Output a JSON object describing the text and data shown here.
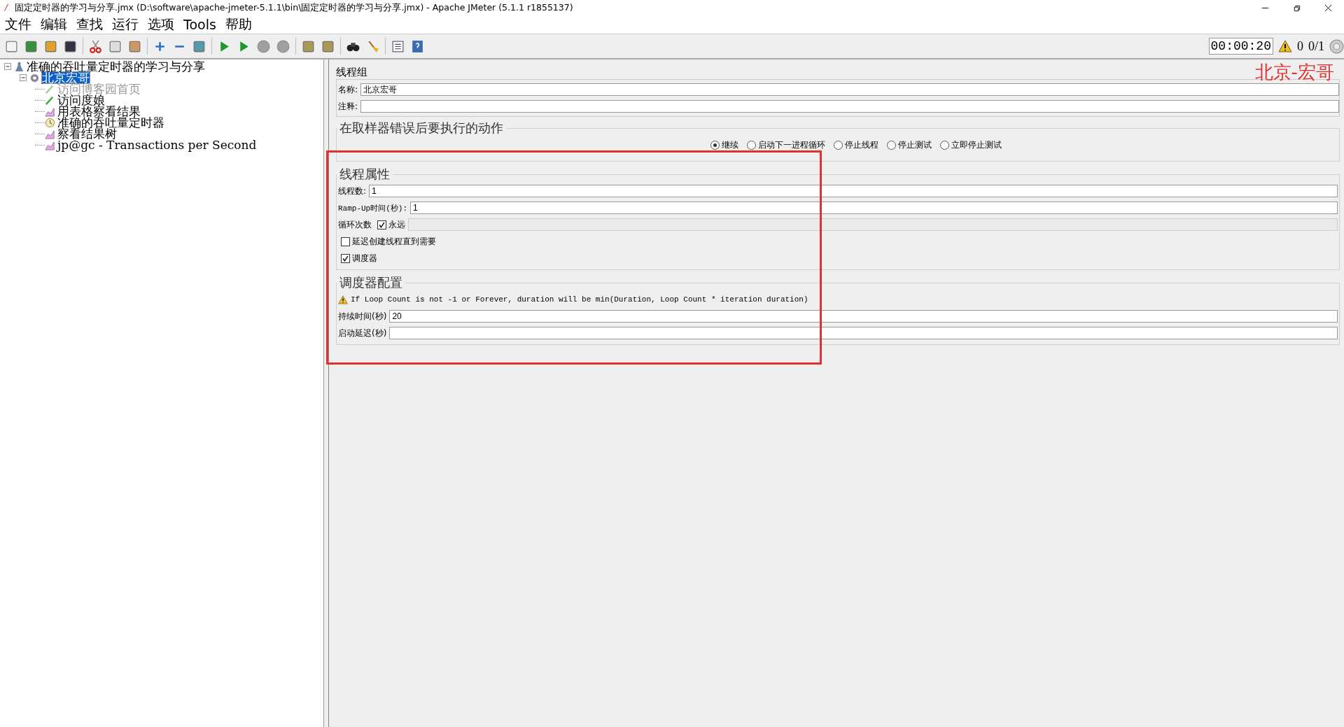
{
  "window": {
    "title": "固定定时器的学习与分享.jmx (D:\\software\\apache-jmeter-5.1.1\\bin\\固定定时器的学习与分享.jmx) - Apache JMeter (5.1.1 r1855137)"
  },
  "menu": [
    "文件",
    "编辑",
    "查找",
    "运行",
    "选项",
    "Tools",
    "帮助"
  ],
  "toolbar": [
    {
      "disabled": false
    },
    {
      "disabled": false
    },
    {
      "disabled": false
    },
    {
      "disabled": false
    },
    {
      "disabled": false
    },
    {
      "disabled": false
    },
    {
      "disabled": false
    },
    {
      "disabled": false
    },
    {
      "disabled": false
    },
    {
      "disabled": false
    },
    {
      "disabled": false
    },
    {
      "disabled": false
    },
    {
      "disabled": true
    },
    {
      "disabled": true
    },
    {
      "disabled": false
    },
    {
      "disabled": false
    },
    {
      "disabled": false
    },
    {
      "disabled": false
    },
    {
      "disabled": false
    },
    {
      "disabled": false
    }
  ],
  "status": {
    "timer": "00:00:20",
    "warnings": "0",
    "threads": "0/1"
  },
  "tree": [
    {
      "label": "准确的吞吐量定时器的学习与分享",
      "kind": "plan",
      "expanded": true,
      "selected": false,
      "children": [
        {
          "label": "北京宏哥",
          "kind": "group",
          "expanded": true,
          "selected": true,
          "disabled": false,
          "children": [
            {
              "label": "访问博客园首页",
              "kind": "sampler",
              "selected": false,
              "disabled": true
            },
            {
              "label": "访问度娘",
              "kind": "sampler",
              "selected": false,
              "disabled": false
            },
            {
              "label": "用表格察看结果",
              "kind": "listener",
              "selected": false,
              "disabled": false
            },
            {
              "label": "准确的吞吐量定时器",
              "kind": "timer",
              "selected": false,
              "disabled": false
            },
            {
              "label": "察看结果树",
              "kind": "listener",
              "selected": false,
              "disabled": false
            },
            {
              "label": "jp@gc - Transactions per Second",
              "kind": "listener",
              "selected": false,
              "disabled": false
            }
          ]
        }
      ]
    }
  ],
  "panel": {
    "title": "线程组",
    "watermark": "北京-宏哥",
    "name_label": "名称:",
    "name_value": "北京宏哥",
    "comment_label": "注释:",
    "error_section": {
      "title": "在取样器错误后要执行的动作",
      "options": [
        {
          "label": "继续",
          "selected": true
        },
        {
          "label": "启动下一进程循环",
          "selected": false
        },
        {
          "label": "停止线程",
          "selected": false
        },
        {
          "label": "停止测试",
          "selected": false
        },
        {
          "label": "立即停止测试",
          "selected": false
        }
      ]
    },
    "thread_section": {
      "title": "线程属性",
      "threads_label": "线程数:",
      "threads_value": "1",
      "rampup_label": "Ramp-Up时间(秒):",
      "rampup_value": "1",
      "loop_label": "循环次数",
      "forever": {
        "label": "永远",
        "checked": true
      },
      "delay": {
        "label": "延迟创建线程直到需要",
        "checked": false
      },
      "scheduler": {
        "label": "调度器",
        "checked": true
      }
    },
    "scheduler_section": {
      "title": "调度器配置",
      "warning": "If Loop Count is not -1 or Forever, duration will be min(Duration, Loop Count * iteration duration)",
      "duration_label": "持续时间(秒)",
      "duration_value": "20",
      "delay_label": "启动延迟(秒)"
    }
  }
}
